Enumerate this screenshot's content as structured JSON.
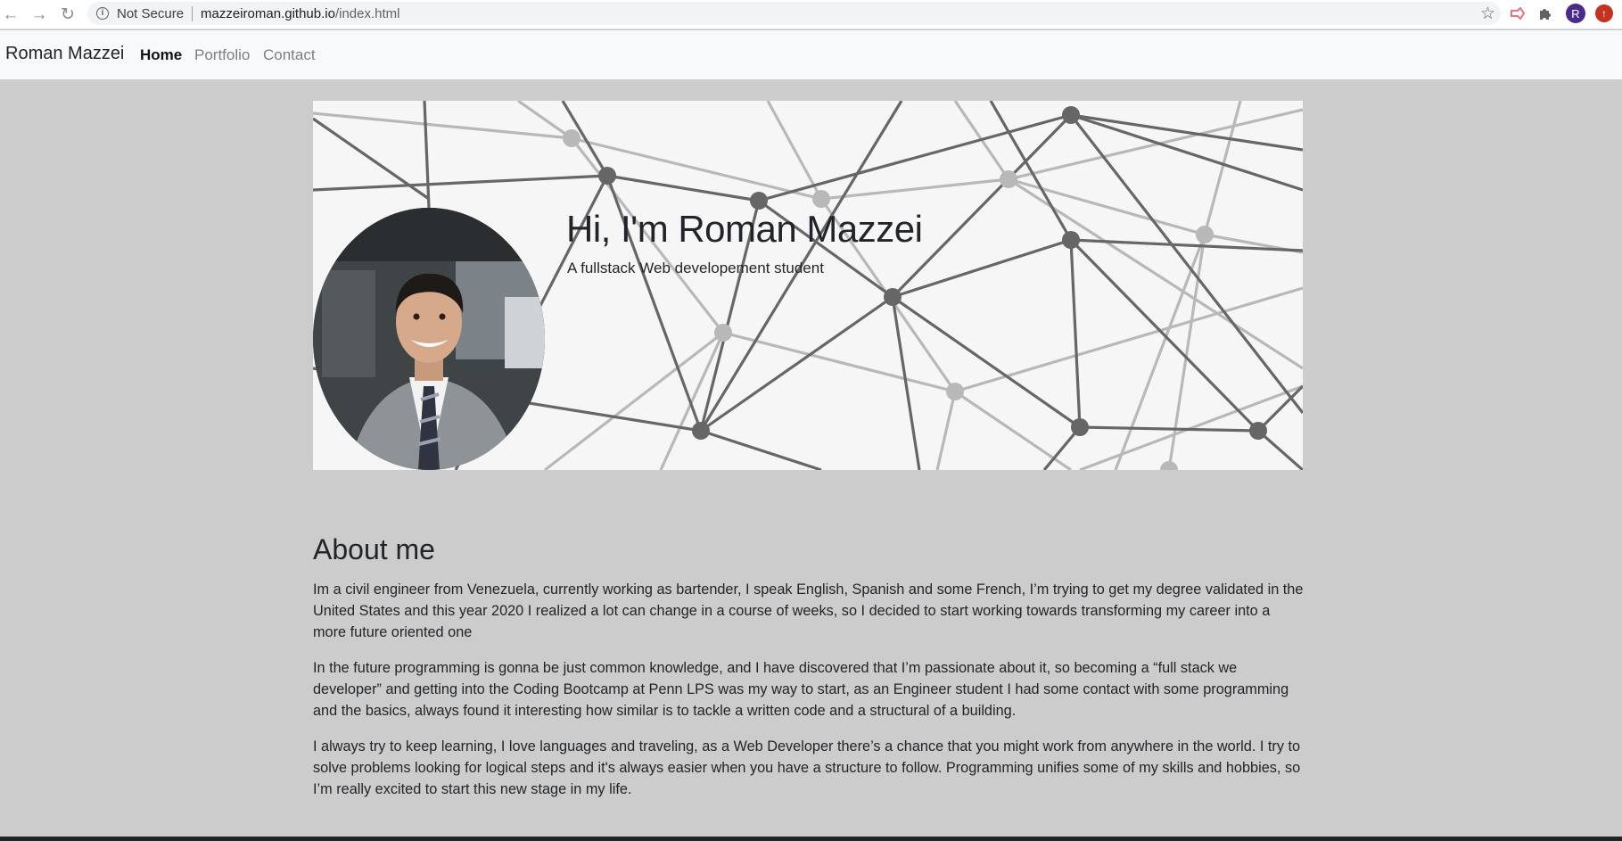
{
  "browser": {
    "security_label": "Not Secure",
    "url_host": "mazzeiroman.github.io",
    "url_path": "/index.html",
    "profile_initial": "R",
    "icons": [
      "back-arrow-icon",
      "forward-arrow-icon",
      "reload-icon",
      "info-icon",
      "star-icon",
      "extension-icon",
      "puzzle-icon",
      "profile-avatar",
      "update-icon"
    ]
  },
  "navbar": {
    "brand": "Roman Mazzei",
    "links": [
      {
        "label": "Home",
        "active": true
      },
      {
        "label": "Portfolio",
        "active": false
      },
      {
        "label": "Contact",
        "active": false
      }
    ]
  },
  "hero": {
    "title": "Hi, I'm Roman Mazzei",
    "subtitle": "A fullstack Web developement student"
  },
  "about": {
    "title": "About me",
    "paragraphs": [
      "Im a civil engineer from Venezuela, currently working as bartender, I speak English, Spanish and some French, I’m trying to get my degree validated in the United States and this year 2020 I realized a lot can change in a course of weeks, so I decided to start working towards transforming my career into a more future oriented one",
      "In the future programming is gonna be just common knowledge, and I have discovered that I’m passionate about it, so becoming a “full stack we developer” and getting into the Coding Bootcamp at Penn LPS was my way to start, as an Engineer student I had some contact with some programming and the basics, always found it interesting how similar is to tackle a written code and a structural of a building.",
      "I always try to keep learning, I love languages and traveling, as a Web Developer there’s a chance that you might work from anywhere in the world. I try to solve problems looking for logical steps and it's always easier when you have a structure to follow. Programming unifies some of my skills and hobbies, so I’m really excited to start this new stage in my life."
    ]
  },
  "colors": {
    "page_bg": "#cccccc",
    "navbar_bg": "#f8f9fa",
    "text": "#212529",
    "nav_inactive": "#7b7f84",
    "network_dark": "#666666",
    "network_light": "#b5b5b5"
  }
}
